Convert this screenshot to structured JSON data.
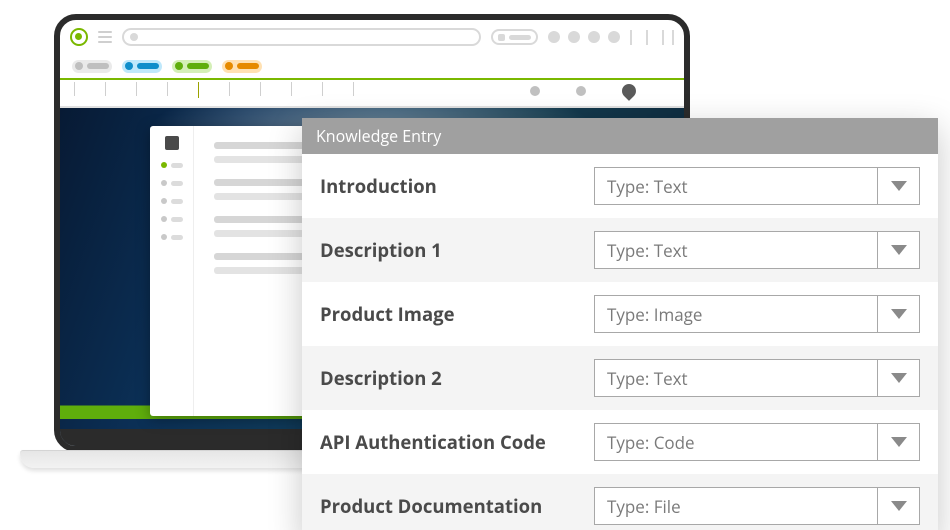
{
  "overlay": {
    "title": "Knowledge Entry",
    "rows": [
      {
        "label": "Introduction",
        "type": "Type: Text"
      },
      {
        "label": "Description 1",
        "type": "Type: Text"
      },
      {
        "label": "Product Image",
        "type": "Type: Image"
      },
      {
        "label": "Description 2",
        "type": "Type: Text"
      },
      {
        "label": "API Authentication Code",
        "type": "Type: Code"
      },
      {
        "label": "Product Documentation",
        "type": "Type: File"
      }
    ]
  }
}
